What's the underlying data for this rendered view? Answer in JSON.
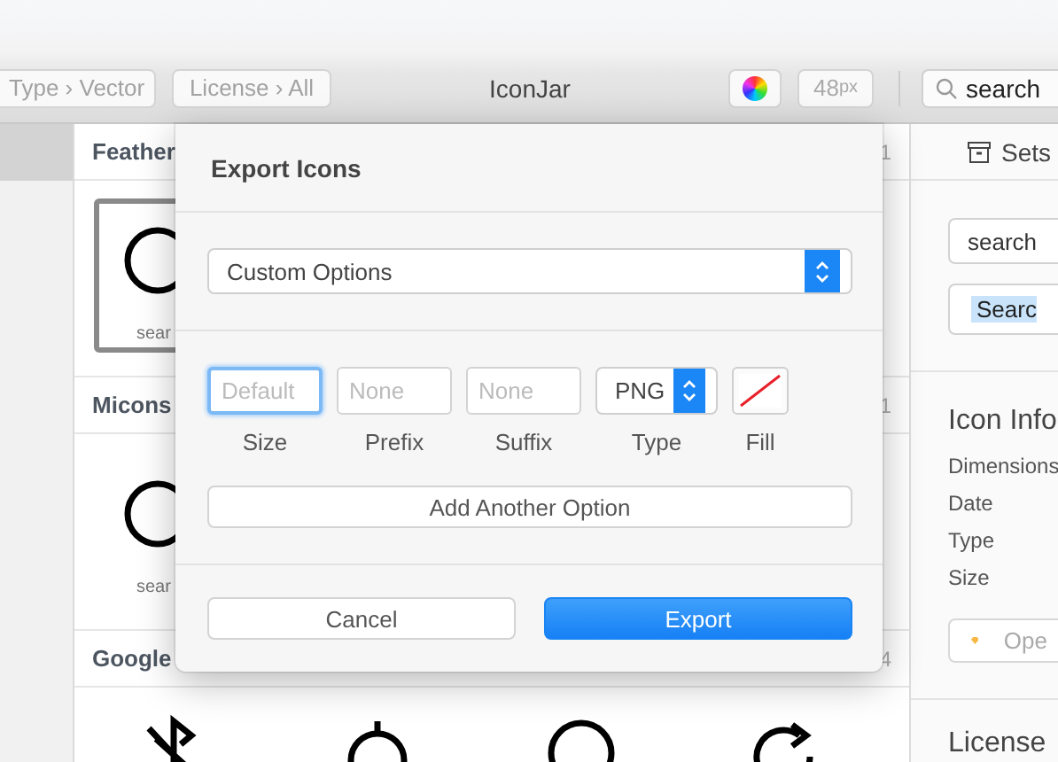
{
  "window": {
    "title": "IconJar"
  },
  "toolbar": {
    "filters": [
      {
        "label": "Type › Vector"
      },
      {
        "label": "License › All"
      }
    ],
    "size": {
      "value": "48",
      "unit": "px"
    },
    "search": {
      "value": "search"
    }
  },
  "sidebar": {
    "items": [
      {
        "selected": true
      }
    ]
  },
  "library": {
    "sections": [
      {
        "name": "Feather",
        "count": "1",
        "icons": [
          {
            "kind": "circle",
            "label": "sear",
            "selected": true
          }
        ]
      },
      {
        "name": "Micons",
        "count": "1",
        "icons": [
          {
            "kind": "circle",
            "label": "sear",
            "selected": false
          }
        ]
      },
      {
        "name": "Google",
        "count": "4",
        "icons": [
          {
            "kind": "bluetooth-off",
            "selected": false
          },
          {
            "kind": "timer",
            "selected": false
          },
          {
            "kind": "circle",
            "selected": false
          },
          {
            "kind": "refresh",
            "selected": false
          }
        ]
      }
    ]
  },
  "inspector": {
    "title": "Sets",
    "search": {
      "value": "search"
    },
    "results": [
      {
        "label": "Searc",
        "selected": true
      }
    ],
    "info_title": "Icon Info",
    "info_fields": [
      "Dimensions",
      "Date",
      "Type",
      "Size"
    ],
    "open_button": "Ope",
    "license_title": "License"
  },
  "dialog": {
    "title": "Export Icons",
    "preset": "Custom Options",
    "options": [
      {
        "kind": "text",
        "placeholder": "Default",
        "label": "Size",
        "focused": true
      },
      {
        "kind": "text",
        "placeholder": "None",
        "label": "Prefix",
        "focused": false
      },
      {
        "kind": "text",
        "placeholder": "None",
        "label": "Suffix",
        "focused": false
      },
      {
        "kind": "select",
        "value": "PNG",
        "label": "Type"
      },
      {
        "kind": "fill",
        "label": "Fill"
      }
    ],
    "add_button": "Add Another Option",
    "buttons": [
      {
        "label": "Cancel",
        "primary": false
      },
      {
        "label": "Export",
        "primary": true
      }
    ]
  }
}
